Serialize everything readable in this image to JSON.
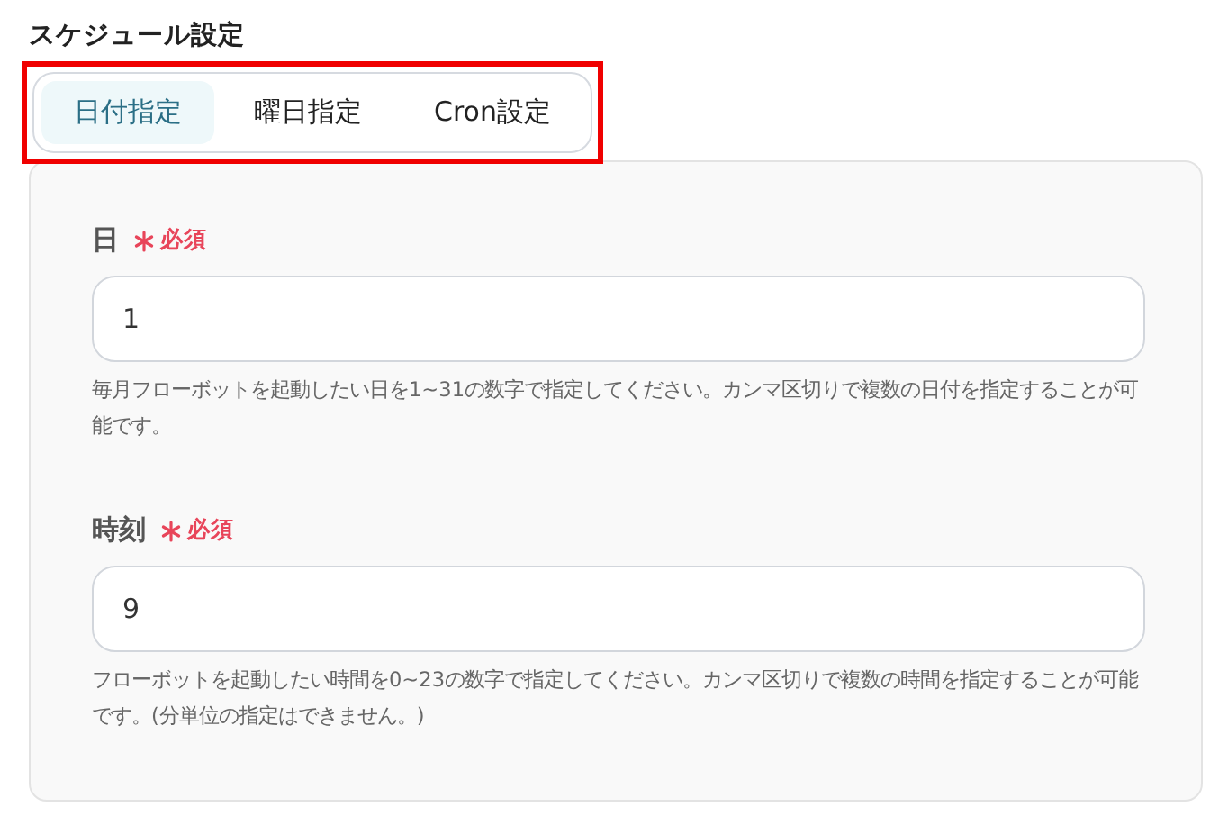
{
  "section_title": "スケジュール設定",
  "tab_group": {
    "highlighted": true,
    "tabs": [
      {
        "label": "日付指定",
        "selected": true
      },
      {
        "label": "曜日指定",
        "selected": false
      },
      {
        "label": "Cron設定",
        "selected": false
      }
    ]
  },
  "fields": [
    {
      "label": "日",
      "required": true,
      "required_text": "必須",
      "value": "1",
      "help": "毎月フローボットを起動したい日を1~31の数字で指定してください。カンマ区切りで複数の日付を指定することが可能です。"
    },
    {
      "label": "時刻",
      "required": true,
      "required_text": "必須",
      "value": "9",
      "help": "フローボットを起動したい時間を0~23の数字で指定してください。カンマ区切りで複数の時間を指定することが可能です。(分単位の指定はできません。)"
    }
  ]
}
